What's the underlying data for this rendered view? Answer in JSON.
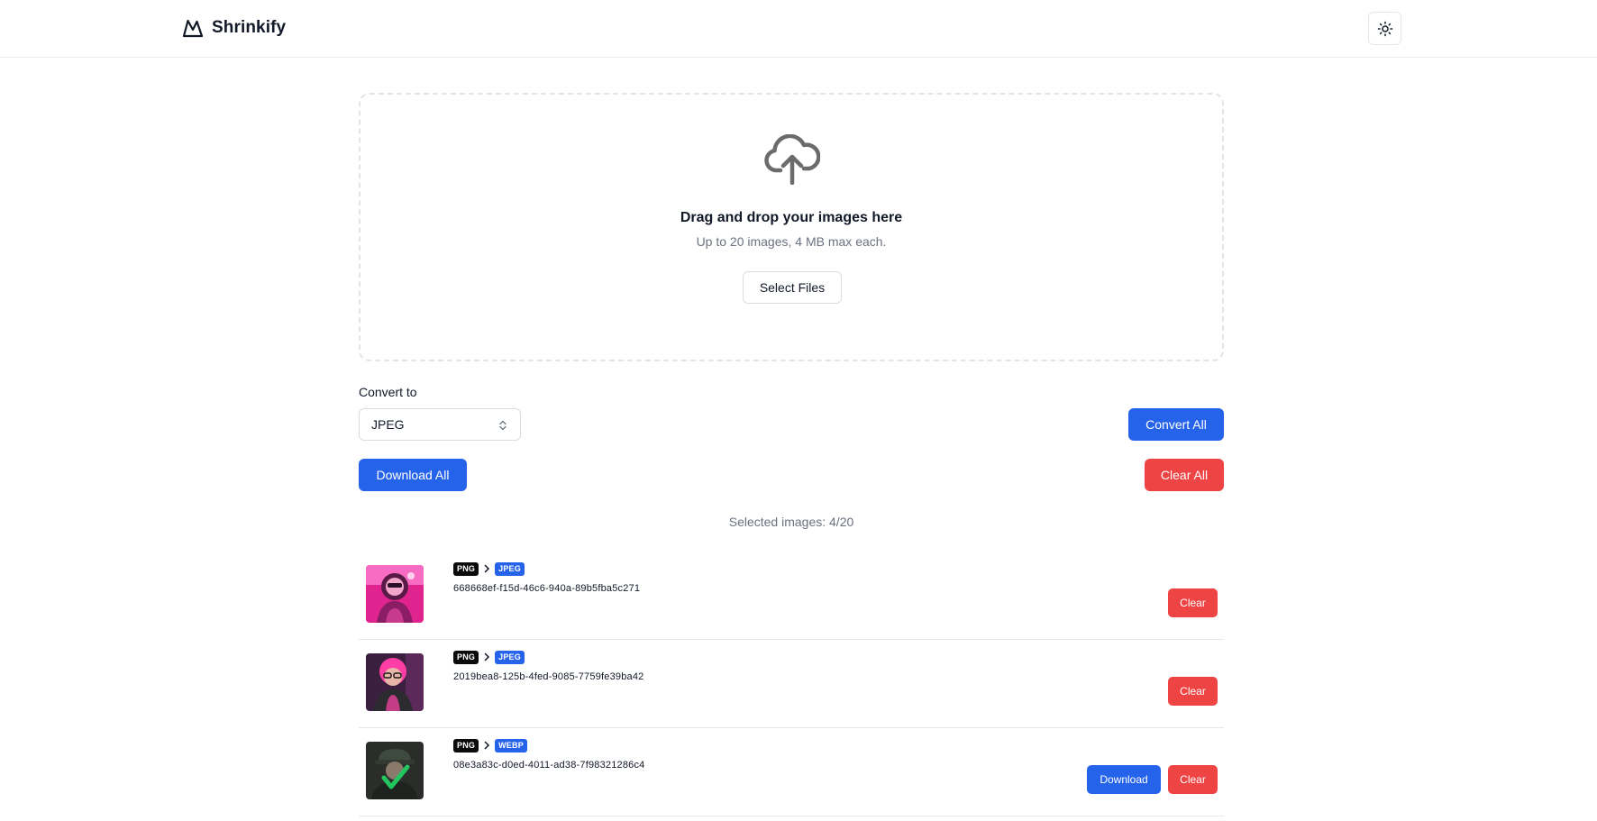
{
  "header": {
    "brand_name": "Shrinkify",
    "logo_icon": "mountain-logo-icon",
    "theme_toggle_icon": "sun-icon"
  },
  "dropzone": {
    "icon": "cloud-upload-icon",
    "title": "Drag and drop your images here",
    "subtitle": "Up to 20 images, 4 MB max each.",
    "select_button": "Select Files"
  },
  "controls": {
    "convert_label": "Convert to",
    "format_value": "JPEG",
    "convert_all": "Convert All",
    "download_all": "Download All",
    "clear_all": "Clear All"
  },
  "selection": {
    "count_text": "Selected images: 4/20"
  },
  "files": [
    {
      "source_format": "PNG",
      "target_format": "JPEG",
      "id": "668668ef-f15d-46c6-940a-89b5fba5c271",
      "download_label": null,
      "clear_label": "Clear"
    },
    {
      "source_format": "PNG",
      "target_format": "JPEG",
      "id": "2019bea8-125b-4fed-9085-7759fe39ba42",
      "download_label": null,
      "clear_label": "Clear"
    },
    {
      "source_format": "PNG",
      "target_format": "WEBP",
      "id": "08e3a83c-d0ed-4011-ad38-7f98321286c4",
      "download_label": "Download",
      "clear_label": "Clear"
    }
  ],
  "colors": {
    "primary": "#2563eb",
    "danger": "#ef4444",
    "badge_source": "#0b0b0b"
  }
}
